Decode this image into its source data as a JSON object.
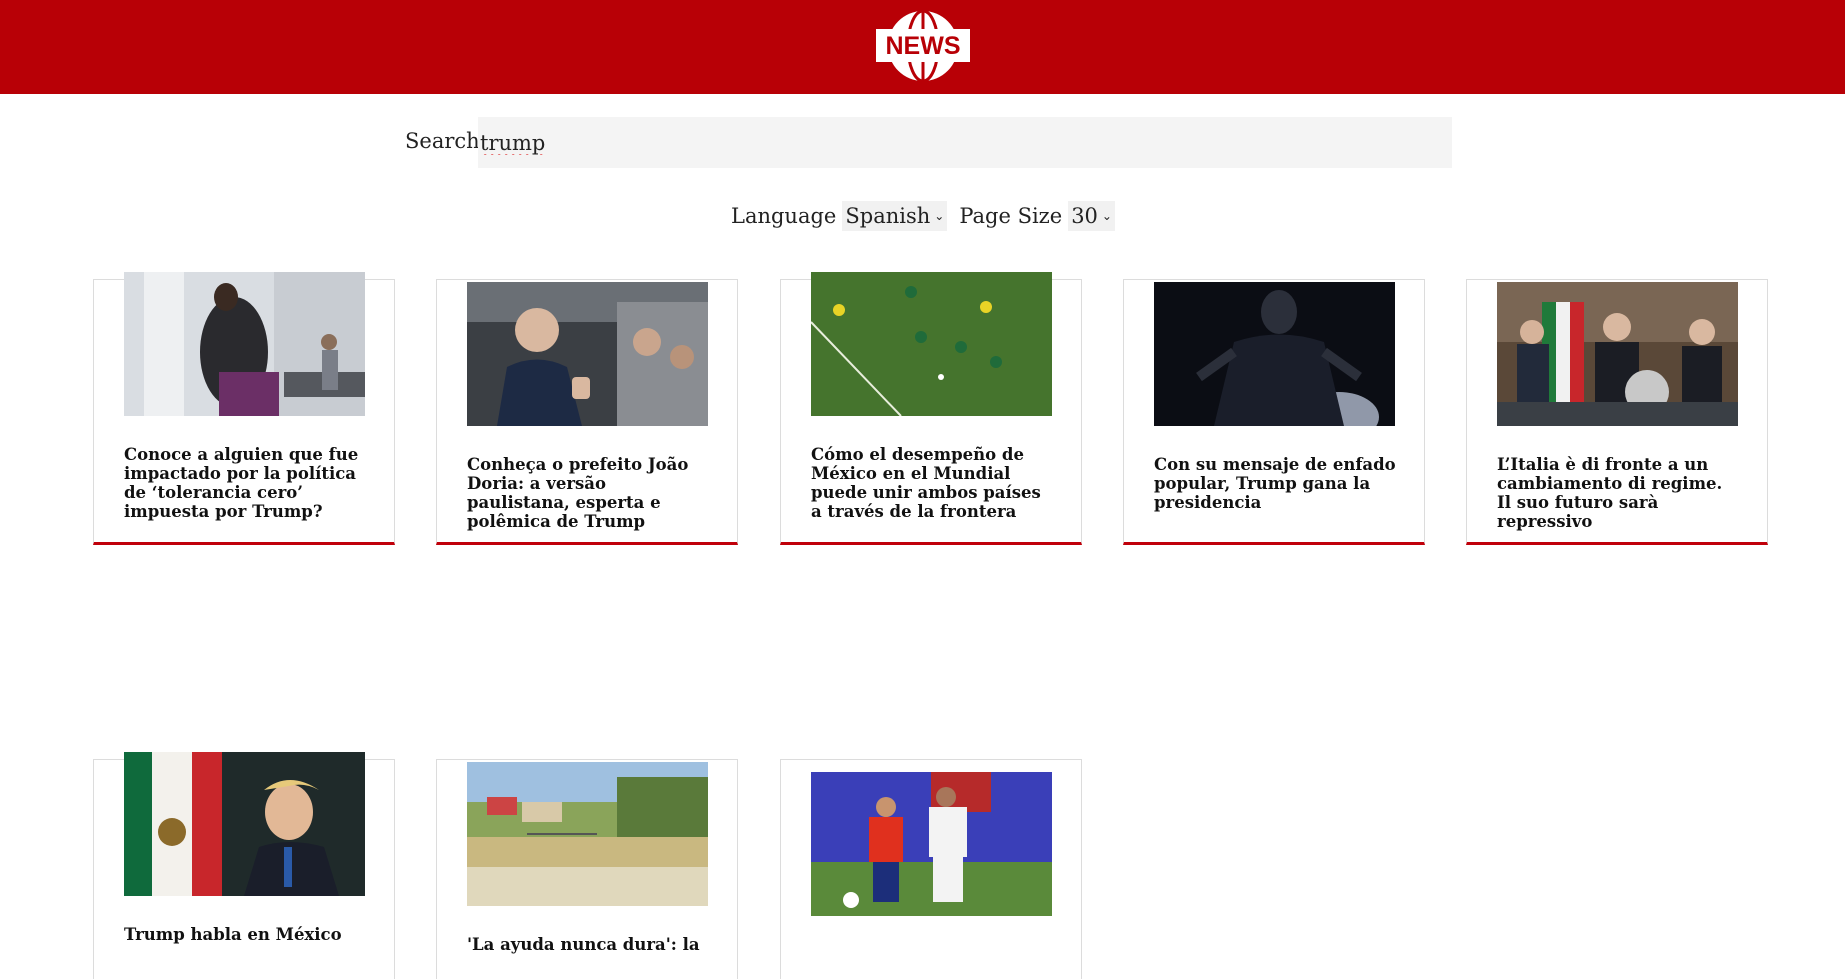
{
  "header": {
    "logo_text": "NEWS"
  },
  "search": {
    "label": "Search",
    "value": "trump"
  },
  "filters": {
    "language_label": "Language",
    "language_value": "Spanish",
    "page_size_label": "Page Size",
    "page_size_value": "30"
  },
  "articles": [
    {
      "title": "Conoce a alguien que fue impactado por la política de ‘tolerancia cero’ impuesta por Trump?",
      "image": "woman-hugging-child-airport-photo"
    },
    {
      "title": "Conheça o prefeito João Doria: a versão paulistana, esperta e polêmica de Trump",
      "image": "man-in-car-thumbs-up-photo"
    },
    {
      "title": "Cómo el desempeño de México en el Mundial puede unir ambos países a través de la frontera",
      "image": "soccer-match-mexico-colombia-photo"
    },
    {
      "title": "Con su mensaje de enfado popular, Trump gana la presidencia",
      "image": "trump-silhouette-stage-photo"
    },
    {
      "title": "L’Italia è di fronte a un cambiamento di regime. Il suo futuro sarà repressivo",
      "image": "italian-politicians-press-conference-photo"
    },
    {
      "title": "Trump habla en México",
      "image": "trump-mexican-flag-photo"
    },
    {
      "title": "'La ayuda nunca dura': la",
      "image": "border-town-buildings-photo"
    },
    {
      "title": "",
      "image": "soccer-chile-player-dribbling-photo"
    }
  ]
}
